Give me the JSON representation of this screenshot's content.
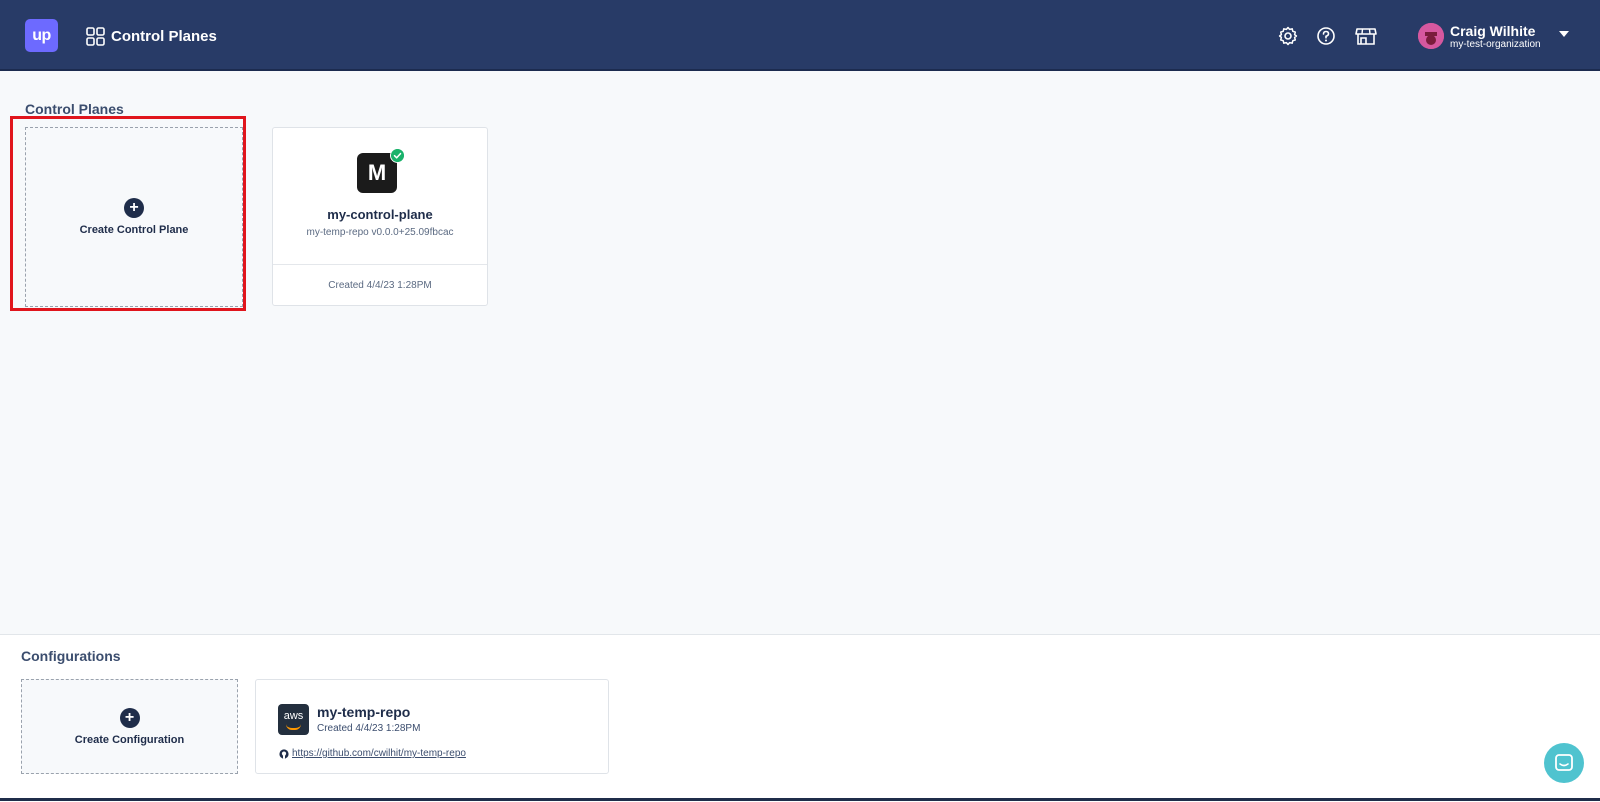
{
  "header": {
    "logo_text": "up",
    "nav_label": "Control Planes",
    "icons": [
      "gear-icon",
      "help-icon",
      "marketplace-icon"
    ],
    "user": {
      "name": "Craig Wilhite",
      "org": "my-test-organization"
    }
  },
  "control_planes": {
    "title": "Control Planes",
    "create_label": "Create Control Plane",
    "items": [
      {
        "badge": "M",
        "name": "my-control-plane",
        "subtitle": "my-temp-repo v0.0.0+25.09fbcac",
        "created": "Created 4/4/23 1:28PM",
        "status_color": "#1ab26b"
      }
    ]
  },
  "configurations": {
    "title": "Configurations",
    "create_label": "Create Configuration",
    "items": [
      {
        "icon_text": "aws",
        "name": "my-temp-repo",
        "created": "Created 4/4/23 1:28PM",
        "link": "https://github.com/cwilhit/my-temp-repo"
      }
    ]
  },
  "colors": {
    "header_bg": "#283b67",
    "accent": "#6d6aff",
    "highlight": "#e0151c",
    "chat": "#4fc3cf"
  }
}
